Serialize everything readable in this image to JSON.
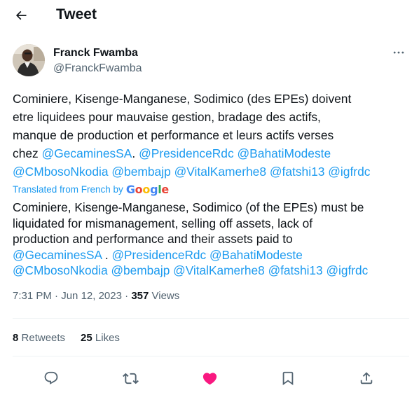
{
  "header": {
    "title": "Tweet",
    "back_icon": "arrow-left-icon"
  },
  "author": {
    "name": "Franck Fwamba",
    "handle": "@FranckFwamba",
    "more_icon": "ellipsis-icon"
  },
  "tweet": {
    "line1": "Cominiere, Kisenge-Manganese, Sodimico (des EPEs) doivent",
    "line2": "etre liquidees pour mauvaise gestion, bradage des actifs,",
    "line3": "manque de production et performance et leurs actifs verses",
    "chez": "chez ",
    "mentions": [
      "@GecaminesSA",
      "@PresidenceRdc",
      "@BahatiModeste",
      "@CMbosoNkodia",
      "@bembajp",
      "@VitalKamerhe8",
      "@fatshi13",
      "@igfrdc"
    ],
    "period": "."
  },
  "translation": {
    "label": "Translated from French by",
    "provider": "Google",
    "line1": "Cominiere, Kisenge-Manganese, Sodimico (of the EPEs) must be",
    "line2": "liquidated for mismanagement, selling off assets, lack of",
    "line3": "production and performance and their assets paid to",
    "mentions": [
      "@GecaminesSA",
      "@PresidenceRdc",
      "@BahatiModeste",
      "@CMbosoNkodia",
      "@bembajp",
      "@VitalKamerhe8",
      "@fatshi13",
      "@igfrdc"
    ],
    "sep": " . "
  },
  "meta": {
    "time": "7:31 PM",
    "dot": "·",
    "date": "Jun 12, 2023",
    "views_count": "357",
    "views_label": "Views"
  },
  "stats": {
    "retweets_count": "8",
    "retweets_label": "Retweets",
    "likes_count": "25",
    "likes_label": "Likes"
  },
  "actions": {
    "reply_icon": "reply-icon",
    "retweet_icon": "retweet-icon",
    "like_icon": "heart-icon",
    "bookmark_icon": "bookmark-icon",
    "share_icon": "share-icon"
  },
  "colors": {
    "accent": "#1d9bf0",
    "like": "#f91880",
    "text": "#0f1419",
    "secondary": "#536471"
  }
}
